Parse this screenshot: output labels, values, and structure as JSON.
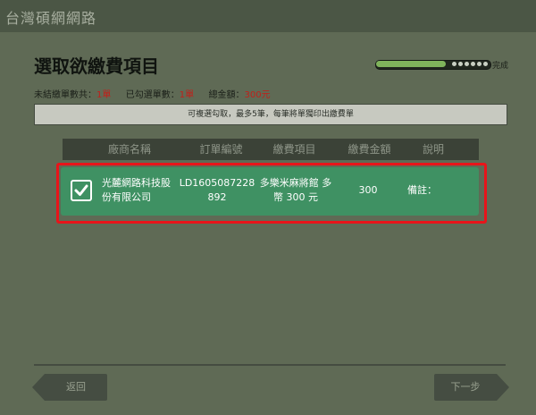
{
  "header": {
    "brand": "台灣碩網網路"
  },
  "page": {
    "title": "選取欲繳費項目"
  },
  "progress": {
    "label": "完成",
    "value": 0.62
  },
  "summary": {
    "unpaid_label": "未結繳單數共：",
    "unpaid_count": "1單",
    "selected_label": "已勾選單數：",
    "selected_count": "1單",
    "total_label": "總金額：",
    "total_amount": "300元"
  },
  "notice": "可複選勾取，最多5筆，每筆將單獨印出繳費單",
  "table": {
    "columns": [
      "廠商名稱",
      "訂單編號",
      "繳費項目",
      "繳費金額",
      "說明"
    ],
    "rows": [
      {
        "checked": true,
        "vendor": "光麓網路科技股份有限公司",
        "order_id": "LD1605087228892",
        "item": "多樂米麻將館 多幣 300 元",
        "amount": "300",
        "note": "備註："
      }
    ]
  },
  "buttons": {
    "back": "返回",
    "next": "下一步"
  },
  "colors": {
    "row_bg": "#3f9163",
    "highlight": "#e8141a",
    "accent_red": "#c0201a"
  },
  "icons": {
    "checkbox": "check-icon"
  }
}
